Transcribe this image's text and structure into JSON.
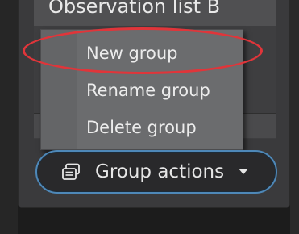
{
  "list": {
    "header_title": "Observation list B"
  },
  "context_menu": {
    "items": [
      {
        "label": "New group",
        "highlighted": true
      },
      {
        "label": "Rename group"
      },
      {
        "label": "Delete group"
      }
    ]
  },
  "group_actions_button": {
    "label": "Group actions",
    "icon": "stacked-windows-icon",
    "dropdown_icon": "caret-down-icon"
  },
  "colors": {
    "annotation": "#e0353a",
    "button_border": "#4e88b8",
    "menu_background": "#6b6c6e"
  }
}
